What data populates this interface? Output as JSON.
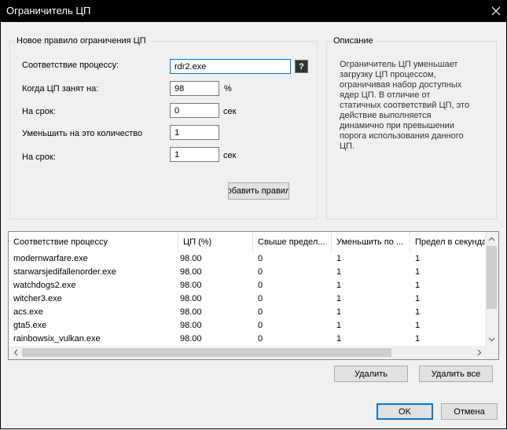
{
  "window": {
    "title": "Ограничитель ЦП"
  },
  "new_rule": {
    "legend": "Новое правило ограничения ЦП",
    "process_label": "Соответствие процессу:",
    "process_value": "rdr2.exe",
    "help_glyph": "?",
    "cpu_busy_label": "Когда ЦП занят на:",
    "cpu_busy_value": "98",
    "cpu_busy_unit": "%",
    "duration_label": "На срок:",
    "duration_value": "0",
    "duration_unit": "сек",
    "reduce_label": "Уменьшить на это количество ядер ЦП:",
    "reduce_value": "1",
    "duration2_label": "На срок:",
    "duration2_value": "1",
    "duration2_unit": "сек",
    "add_button": "обавить правил"
  },
  "description": {
    "legend": "Описание",
    "text": "Ограничитель ЦП уменьшает загрузку ЦП процессом, ограничивая набор доступных ядер ЦП. В отличие от статичных соответствий ЦП, это действие выполняется динамично при превышении порога использования данного ЦП."
  },
  "rules_table": {
    "columns": [
      "Соответствие процессу",
      "ЦП (%)",
      "Свыше предел...",
      "Уменьшить по ...",
      "Предел в секунда"
    ],
    "rows": [
      [
        "modernwarfare.exe",
        "98.00",
        "0",
        "1",
        "1"
      ],
      [
        "starwarsjedifallenorder.exe",
        "98.00",
        "0",
        "1",
        "1"
      ],
      [
        "watchdogs2.exe",
        "98.00",
        "0",
        "1",
        "1"
      ],
      [
        "witcher3.exe",
        "98.00",
        "0",
        "1",
        "1"
      ],
      [
        "acs.exe",
        "98.00",
        "0",
        "1",
        "1"
      ],
      [
        "gta5.exe",
        "98.00",
        "0",
        "1",
        "1"
      ],
      [
        "rainbowsix_vulkan.exe",
        "98.00",
        "0",
        "1",
        "1"
      ]
    ]
  },
  "buttons": {
    "delete": "Удалить",
    "delete_all": "Удалить все",
    "ok": "OK",
    "cancel": "Отмена"
  },
  "icons": {
    "close": "close-icon",
    "help": "help-icon",
    "scroll_up": "chevron-up-icon",
    "scroll_down": "chevron-down-icon",
    "scroll_left": "chevron-left-icon",
    "scroll_right": "chevron-right-icon"
  },
  "colors": {
    "titlebar": "#000000",
    "focus_border": "#0078d7",
    "button_face": "#e1e1e1"
  }
}
